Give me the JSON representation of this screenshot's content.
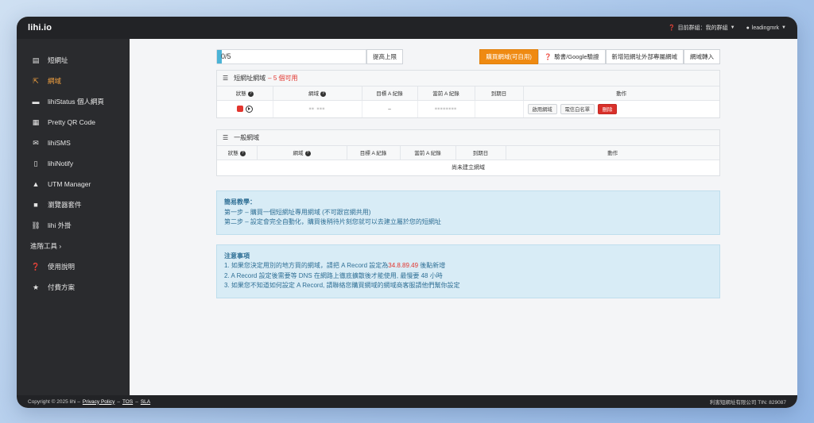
{
  "app": {
    "brand": "lihi.io"
  },
  "topbar": {
    "group_label": "目前群組：我的群組",
    "user_label": "leadingmrk"
  },
  "sidebar": {
    "items": [
      {
        "label": "短網址",
        "icon": "list-icon"
      },
      {
        "label": "網域",
        "icon": "external-link-icon"
      },
      {
        "label": "lihiStatus 個人網頁",
        "icon": "card-icon"
      },
      {
        "label": "Pretty QR Code",
        "icon": "qrcode-icon"
      },
      {
        "label": "lihiSMS",
        "icon": "envelope-icon"
      },
      {
        "label": "lihiNotify",
        "icon": "mobile-icon"
      },
      {
        "label": "UTM Manager",
        "icon": "tag-icon"
      },
      {
        "label": "瀏覽器套件",
        "icon": "bookmark-icon"
      },
      {
        "label": "lihi 外掛",
        "icon": "link-icon"
      }
    ],
    "advanced": "進階工具 ›",
    "bottom_items": [
      {
        "label": "使用說明",
        "icon": "question-icon"
      },
      {
        "label": "付費方案",
        "icon": "star-icon"
      }
    ]
  },
  "quota": {
    "text": "0/5",
    "progress": 0,
    "raise_button": "提高上限"
  },
  "actions": {
    "buy": "購買網域(可自用)",
    "verify": "驗書/Google驗證",
    "add_external": "新增短網址外部專屬網域",
    "transfer": "網域轉入"
  },
  "short_domain_panel": {
    "title": "短網址網域",
    "available": "– 5 個可用",
    "columns": [
      "狀態",
      "網域",
      "目標 A 紀錄",
      "當前 A 紀錄",
      "到期日",
      "動作"
    ],
    "rows": [
      {
        "domain": "▪▪ ▪▪▪",
        "target_a": "–",
        "current_a": "▪▪▪▪▪▪▪▪",
        "expiry": "",
        "btn_enable": "啟用網域",
        "btn_whitelist": "電信白名單",
        "btn_delete": "刪除"
      }
    ]
  },
  "general_panel": {
    "title": "一般網域",
    "columns": [
      "狀態",
      "網域",
      "目標 A 紀錄",
      "當前 A 紀錄",
      "到期日",
      "動作"
    ],
    "empty": "尚未建立網域"
  },
  "tutorial": {
    "title": "簡易教學：",
    "line1": "第一步 – 購買一個短網址專用網域 (不可跟官網共用)",
    "line2": "第二步 – 設定會完全自動化，購買後稍待片刻您就可以去建立屬於您的短網址"
  },
  "notice": {
    "title": "注意事項",
    "line1_pre": "1. 如果您決定用別的地方買的網域，請把 A Record 設定為",
    "line1_ip": "34.8.89.49",
    "line1_post": " 後點新增",
    "line2": "2. A Record 設定後需要等 DNS 在網路上徹底擴散後才能使用, 最慢要 48 小時",
    "line3": "3. 如果您不知道如何設定 A Record, 請聯絡您購買網域的網域商客服請他們幫你設定"
  },
  "footer": {
    "copyright": "Copyright © 2025 lihi –",
    "privacy": "Privacy Policy",
    "tos": "TOS",
    "sla": "SLA",
    "company": "利害短網址有限公司 TIN: 829087"
  },
  "colors": {
    "accent": "#ef8a12",
    "danger": "#e2352e",
    "info_bg": "#d8ecf6"
  }
}
